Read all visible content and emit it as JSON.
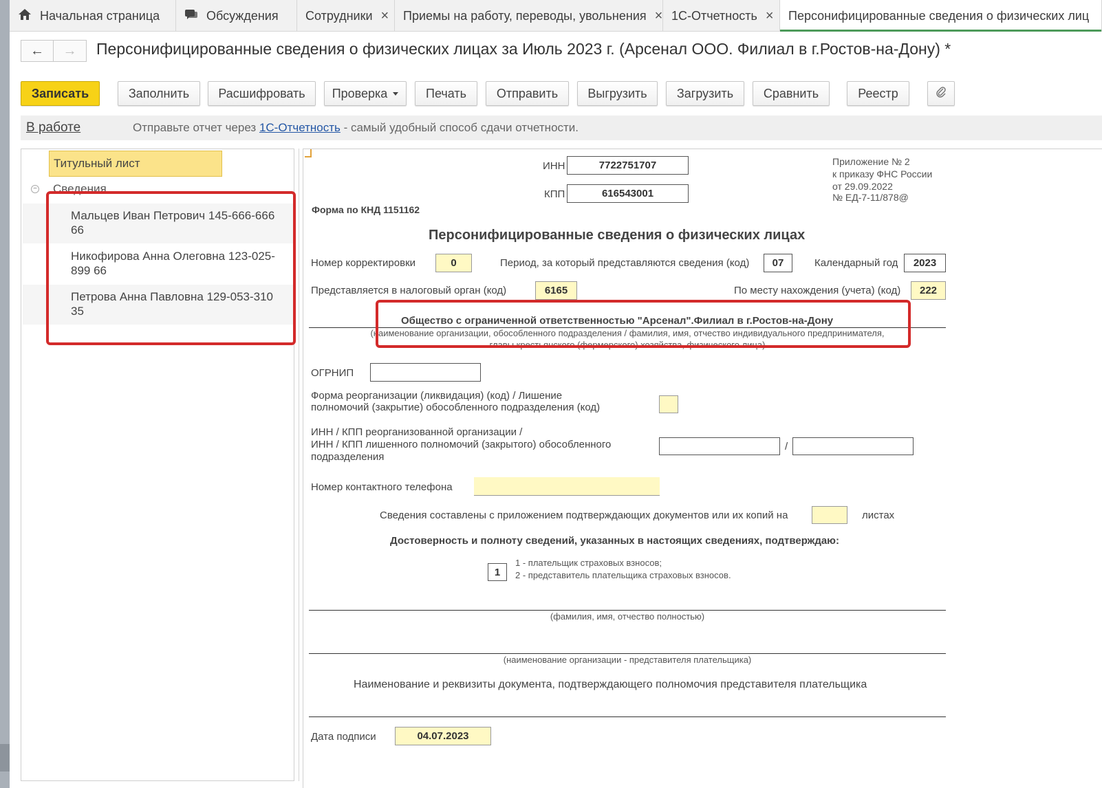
{
  "tabs": [
    {
      "label": "Начальная страница",
      "icon": "home-icon",
      "closable": false
    },
    {
      "label": "Обсуждения",
      "icon": "chat-icon",
      "closable": false
    },
    {
      "label": "Сотрудники",
      "closable": true
    },
    {
      "label": "Приемы на работу, переводы, увольнения",
      "closable": true
    },
    {
      "label": "1С-Отчетность",
      "closable": true
    },
    {
      "label": "Персонифицированные сведения о физических лиц",
      "closable": false,
      "active": true
    }
  ],
  "tab_close_glyph": "×",
  "nav": {
    "back": "←",
    "forward": "→"
  },
  "document_title": "Персонифицированные сведения о физических лицах за Июль 2023 г. (Арсенал ООО. Филиал в г.Ростов-на-Дону) *",
  "toolbar": {
    "save": "Записать",
    "fill": "Заполнить",
    "decode": "Расшифровать",
    "check": "Проверка",
    "print": "Печать",
    "send": "Отправить",
    "export": "Выгрузить",
    "import": "Загрузить",
    "compare": "Сравнить",
    "registry": "Реестр",
    "attach_icon": "paperclip-icon"
  },
  "status": {
    "state": "В работе",
    "message_before": "Отправьте отчет через ",
    "message_link": "1С-Отчетность",
    "message_after": " - самый удобный способ сдачи отчетности."
  },
  "tree": {
    "title_sheet": "Титульный лист",
    "section": "Сведения",
    "items": [
      {
        "label": "Мальцев Иван Петрович 145-666-666 66"
      },
      {
        "label": "Никофирова Анна Олеговна 123-025-899 66"
      },
      {
        "label": "Петрова Анна Павловна 129-053-310 35"
      }
    ]
  },
  "form": {
    "inn_label": "ИНН",
    "inn": "7722751707",
    "kpp_label": "КПП",
    "kpp": "616543001",
    "appendix": [
      "Приложение № 2",
      "к приказу ФНС России",
      "от 29.09.2022",
      "№ ЕД-7-11/878@"
    ],
    "knd": "Форма по КНД 1151162",
    "heading": "Персонифицированные сведения о физических лицах",
    "correction_label": "Номер корректировки",
    "correction": "0",
    "period_label": "Период, за который представляются сведения (код)",
    "period": "07",
    "year_label": "Календарный год",
    "year": "2023",
    "tax_authority_label": "Представляется в налоговый орган (код)",
    "tax_authority": "6165",
    "location_label": "По месту нахождения (учета) (код)",
    "location": "222",
    "org_name": "Общество с ограниченной ответственностью \"Арсенал\".Филиал в г.Ростов-на-Дону",
    "org_caption_1": "(наименование организации, обособленного подразделения / фамилия, имя, отчество индивидуального предпринимателя,",
    "org_caption_2": "главы крестьянского (фермерского) хозяйства, физического лица)",
    "ogrnip_label": "ОГРНИП",
    "ogrnip": "",
    "reorg_label_1": "Форма реорганизации (ликвидация) (код) / Лишение",
    "reorg_label_2": "полномочий (закрытие) обособленного подразделения (код)",
    "reorg_code": "",
    "reorg_inn_label_1": "ИНН / КПП реорганизованной организации /",
    "reorg_inn_label_2": "ИНН / КПП лишенного полномочий (закрытого) обособленного",
    "reorg_inn_label_3": "подразделения",
    "reorg_inn": "",
    "reorg_kpp": "",
    "slash": "/",
    "phone_label": "Номер контактного телефона",
    "phone": "",
    "attached_label": "Сведения составлены с приложением подтверждающих документов или их копий на",
    "attached_pages": "",
    "pages_label": "листах",
    "confirm_heading": "Достоверность и полноту сведений, указанных в настоящих сведениях, подтверждаю:",
    "signer_code": "1",
    "signer_option_1": "1 - плательщик страховых взносов;",
    "signer_option_2": "2 - представитель плательщика страховых взносов.",
    "fio_caption": "(фамилия, имя, отчество полностью)",
    "rep_org_caption": "(наименование организации - представителя плательщика)",
    "rep_doc_label": "Наименование и реквизиты документа, подтверждающего полномочия представителя плательщика",
    "sign_date_label": "Дата подписи",
    "sign_date": "04.07.2023"
  },
  "colors": {
    "primary_button": "#f7d217",
    "highlight_box": "#d32a2a",
    "yellow_field": "#fff9c4",
    "active_tab_underline": "#4c9a5a",
    "link": "#2457a5"
  }
}
